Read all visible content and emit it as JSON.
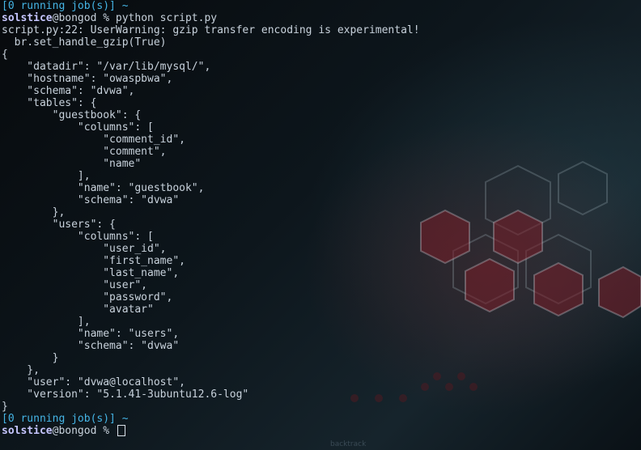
{
  "terminal": {
    "job_status_top": "[0 running job(s)] ~",
    "prompt_user": "solstice",
    "prompt_rest_1": "@bongod % python script.py",
    "warning_line": "script.py:22: UserWarning: gzip transfer encoding is experimental!",
    "warning_code": "  br.set_handle_gzip(True)",
    "output_lines": [
      "{",
      "    \"datadir\": \"/var/lib/mysql/\",",
      "    \"hostname\": \"owaspbwa\",",
      "    \"schema\": \"dvwa\",",
      "    \"tables\": {",
      "        \"guestbook\": {",
      "            \"columns\": [",
      "                \"comment_id\",",
      "                \"comment\",",
      "                \"name\"",
      "            ],",
      "            \"name\": \"guestbook\",",
      "            \"schema\": \"dvwa\"",
      "        },",
      "        \"users\": {",
      "            \"columns\": [",
      "                \"user_id\",",
      "                \"first_name\",",
      "                \"last_name\",",
      "                \"user\",",
      "                \"password\",",
      "                \"avatar\"",
      "            ],",
      "            \"name\": \"users\",",
      "            \"schema\": \"dvwa\"",
      "        }",
      "    },",
      "    \"user\": \"dvwa@localhost\",",
      "    \"version\": \"5.1.41-3ubuntu12.6-log\"",
      "}"
    ],
    "job_status_bottom": "[0 running job(s)] ~",
    "prompt_rest_2": "@bongod % "
  },
  "wallpaper_brand": "backtrack",
  "colors": {
    "job_status": "#45b5e6",
    "username": "#c6c6ff",
    "text": "#c8d2dc"
  }
}
